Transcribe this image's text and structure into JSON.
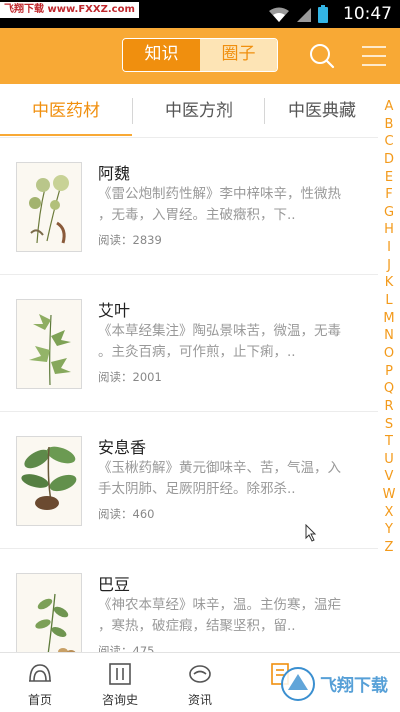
{
  "status_bar": {
    "watermark": "飞翔下载 www.FXXZ.com",
    "time": "10:47"
  },
  "header": {
    "segments": [
      "知识",
      "圈子"
    ],
    "active_segment": "知识",
    "search_icon": "search-icon",
    "menu_icon": "menu-icon",
    "accent_color": "#f8a935"
  },
  "tabs": [
    "中医药材",
    "中医方剂",
    "中医典藏"
  ],
  "alphabet": [
    "A",
    "B",
    "C",
    "D",
    "E",
    "F",
    "G",
    "H",
    "I",
    "J",
    "K",
    "L",
    "M",
    "N",
    "O",
    "P",
    "Q",
    "R",
    "S",
    "T",
    "U",
    "V",
    "W",
    "X",
    "Y",
    "Z"
  ],
  "items": [
    {
      "name": "阿魏",
      "desc_line1": "《雷公炮制药性解》李中梓味辛，性微热",
      "desc_line2": "，无毒，入胃经。主破癥积，下..",
      "reads": "阅读：2839"
    },
    {
      "name": "艾叶",
      "desc_line1": "《本草经集注》陶弘景味苦，微温，无毒",
      "desc_line2": "。主灸百病，可作煎，止下痢，..",
      "reads": "阅读：2001"
    },
    {
      "name": "安息香",
      "desc_line1": "《玉楸药解》黄元御味辛、苦，气温，入",
      "desc_line2": "手太阴肺、足厥阴肝经。除邪杀..",
      "reads": "阅读：460"
    },
    {
      "name": "巴豆",
      "desc_line1": "《神农本草经》味辛，温。主伤寒，温疟",
      "desc_line2": "，寒热，破症瘕，结聚坚积，留..",
      "reads": "阅读：475"
    }
  ],
  "bottom_nav": [
    {
      "label": "首页",
      "icon": "home-icon"
    },
    {
      "label": "咨询史",
      "icon": "history-icon"
    },
    {
      "label": "资讯",
      "icon": "news-icon"
    },
    {
      "label": "",
      "icon": "knowledge-icon"
    }
  ],
  "logo_watermark": "飞翔下载"
}
